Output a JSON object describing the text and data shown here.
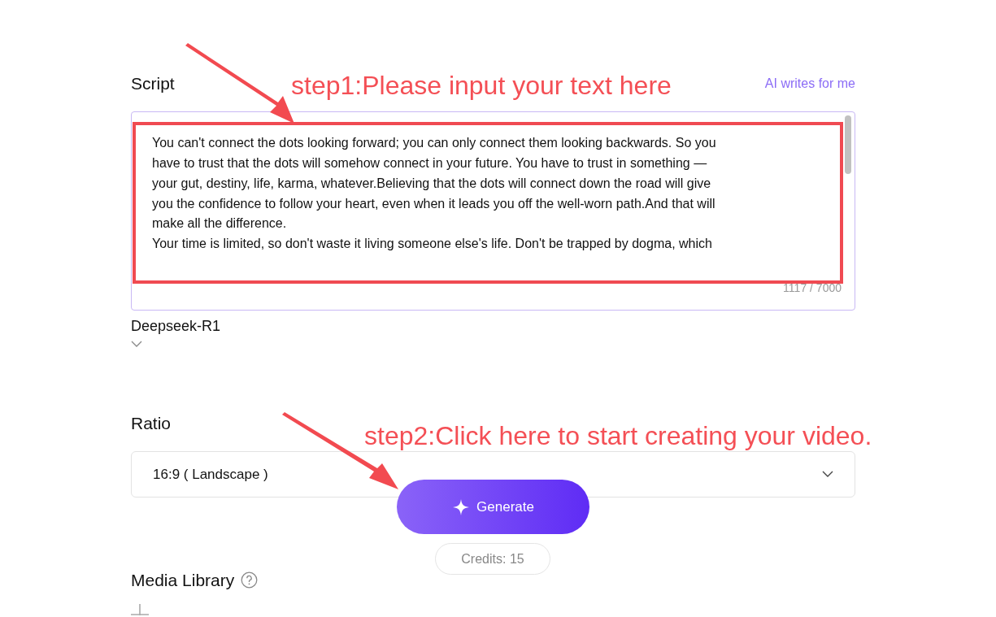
{
  "script_section": {
    "label": "Script",
    "ai_link": "AI writes for me",
    "text_lines": [
      "You can't connect the dots looking forward; you can only connect them looking backwards. So you",
      "have to trust that the dots will somehow connect in your future. You have to trust in something —",
      "your gut, destiny, life, karma, whatever.Believing that the dots will connect down the road will give",
      "you the confidence to follow your heart, even when it leads you off the well-worn path.And that will",
      "make all the difference.",
      "Your time is limited, so don't waste it living someone else's life. Don't be trapped by dogma, which"
    ],
    "counter": "1117 / 7000",
    "model": "Deepseek-R1"
  },
  "ratio_section": {
    "label": "Ratio",
    "value": "16:9 ( Landscape )"
  },
  "generate_button": {
    "label": "Generate"
  },
  "credits": "Credits: 15",
  "media_library": {
    "label": "Media Library"
  },
  "annotations": [
    {
      "text": "step1:Please input your text here"
    },
    {
      "text": "step2:Click here to start creating your video."
    }
  ]
}
